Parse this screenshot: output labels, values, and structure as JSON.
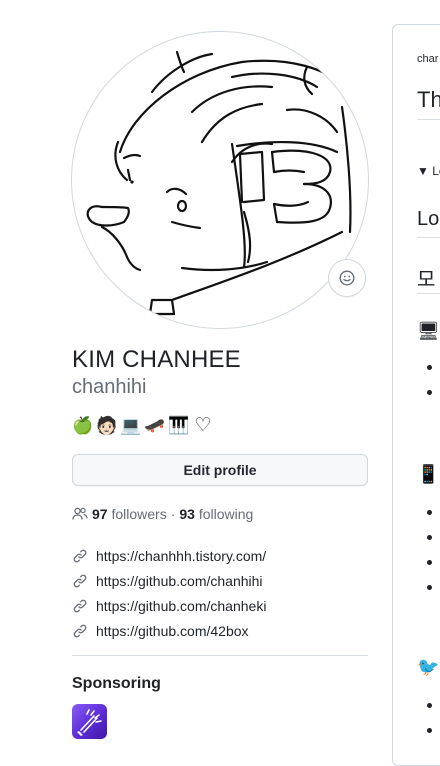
{
  "profile": {
    "full_name": "KIM CHANHEE",
    "username": "chanhihi",
    "bio_emojis": [
      "🍏",
      "🧑🏻",
      "💻",
      "🛹",
      "🎹",
      "♡"
    ],
    "edit_profile_label": "Edit profile",
    "followers_count": "97",
    "followers_label": "followers",
    "separator": "·",
    "following_count": "93",
    "following_label": "following",
    "links": [
      "https://chanhhh.tistory.com/",
      "https://github.com/chanhihi",
      "https://github.com/chanheki",
      "https://github.com/42box"
    ],
    "sponsoring_title": "Sponsoring"
  },
  "readme": {
    "path_text": "char",
    "heading": "Th",
    "details_text": "▼ Lc",
    "section_heading": "Lo",
    "korean_heading": "모",
    "icons": [
      "🖥",
      "📱",
      "🐦"
    ]
  },
  "colors": {
    "text": "#1f2328",
    "muted": "#656d76",
    "border": "#d0d7de",
    "button_bg": "#f6f8fa",
    "sponsor_purple": "#6b3de0"
  }
}
